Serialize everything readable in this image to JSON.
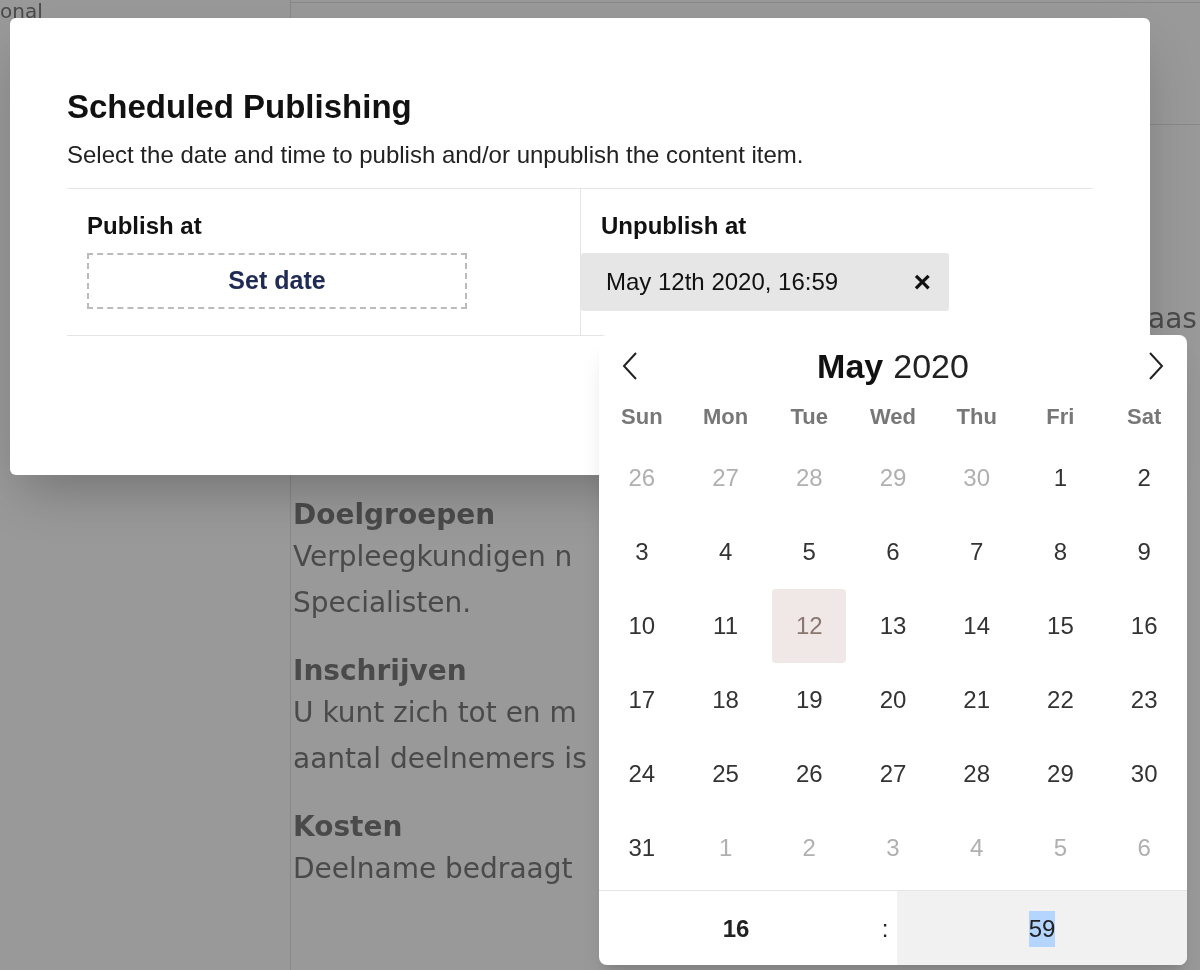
{
  "background": {
    "corner_text": "onal",
    "sections": [
      {
        "heading": "Doelgroepen",
        "lines": [
          "Verpleegkundigen n",
          "Specialisten."
        ]
      },
      {
        "heading": "Inschrijven",
        "lines": [
          "U kunt zich tot en m",
          "aantal deelnemers is"
        ]
      },
      {
        "heading": "Kosten",
        "lines": [
          "Deelname bedraagt"
        ]
      }
    ],
    "edge_fragments": [
      "aas"
    ]
  },
  "modal": {
    "title": "Scheduled Publishing",
    "description": "Select the date and time to publish and/or unpublish the content item.",
    "columns": [
      {
        "label": "Publish at",
        "kind": "empty",
        "button": "Set date"
      },
      {
        "label": "Unpublish at",
        "kind": "value",
        "value": "May 12th 2020, 16:59",
        "clear": "×"
      }
    ]
  },
  "datepicker": {
    "month": "May",
    "year": "2020",
    "weekdays": [
      "Sun",
      "Mon",
      "Tue",
      "Wed",
      "Thu",
      "Fri",
      "Sat"
    ],
    "days": [
      {
        "label": "26",
        "outside": true,
        "selected": false
      },
      {
        "label": "27",
        "outside": true,
        "selected": false
      },
      {
        "label": "28",
        "outside": true,
        "selected": false
      },
      {
        "label": "29",
        "outside": true,
        "selected": false
      },
      {
        "label": "30",
        "outside": true,
        "selected": false
      },
      {
        "label": "1",
        "outside": false,
        "selected": false
      },
      {
        "label": "2",
        "outside": false,
        "selected": false
      },
      {
        "label": "3",
        "outside": false,
        "selected": false
      },
      {
        "label": "4",
        "outside": false,
        "selected": false
      },
      {
        "label": "5",
        "outside": false,
        "selected": false
      },
      {
        "label": "6",
        "outside": false,
        "selected": false
      },
      {
        "label": "7",
        "outside": false,
        "selected": false
      },
      {
        "label": "8",
        "outside": false,
        "selected": false
      },
      {
        "label": "9",
        "outside": false,
        "selected": false
      },
      {
        "label": "10",
        "outside": false,
        "selected": false
      },
      {
        "label": "11",
        "outside": false,
        "selected": false
      },
      {
        "label": "12",
        "outside": false,
        "selected": true
      },
      {
        "label": "13",
        "outside": false,
        "selected": false
      },
      {
        "label": "14",
        "outside": false,
        "selected": false
      },
      {
        "label": "15",
        "outside": false,
        "selected": false
      },
      {
        "label": "16",
        "outside": false,
        "selected": false
      },
      {
        "label": "17",
        "outside": false,
        "selected": false
      },
      {
        "label": "18",
        "outside": false,
        "selected": false
      },
      {
        "label": "19",
        "outside": false,
        "selected": false
      },
      {
        "label": "20",
        "outside": false,
        "selected": false
      },
      {
        "label": "21",
        "outside": false,
        "selected": false
      },
      {
        "label": "22",
        "outside": false,
        "selected": false
      },
      {
        "label": "23",
        "outside": false,
        "selected": false
      },
      {
        "label": "24",
        "outside": false,
        "selected": false
      },
      {
        "label": "25",
        "outside": false,
        "selected": false
      },
      {
        "label": "26",
        "outside": false,
        "selected": false
      },
      {
        "label": "27",
        "outside": false,
        "selected": false
      },
      {
        "label": "28",
        "outside": false,
        "selected": false
      },
      {
        "label": "29",
        "outside": false,
        "selected": false
      },
      {
        "label": "30",
        "outside": false,
        "selected": false
      },
      {
        "label": "31",
        "outside": false,
        "selected": false
      },
      {
        "label": "1",
        "outside": true,
        "selected": false
      },
      {
        "label": "2",
        "outside": true,
        "selected": false
      },
      {
        "label": "3",
        "outside": true,
        "selected": false
      },
      {
        "label": "4",
        "outside": true,
        "selected": false
      },
      {
        "label": "5",
        "outside": true,
        "selected": false
      },
      {
        "label": "6",
        "outside": true,
        "selected": false
      }
    ],
    "time": {
      "hour": "16",
      "separator": ":",
      "minute": "59",
      "minute_selected": true
    }
  }
}
